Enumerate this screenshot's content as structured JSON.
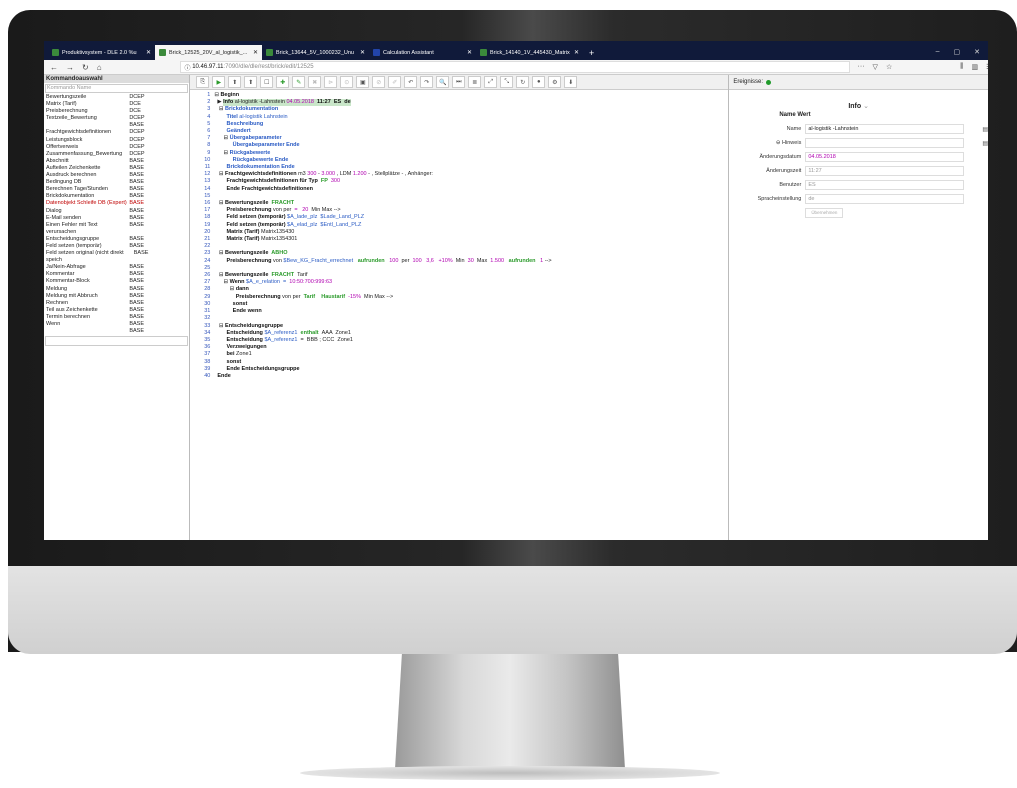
{
  "browser": {
    "tabs": [
      {
        "label": "Produktivsystem - DLE 2.0 %u",
        "active": false
      },
      {
        "label": "Brick_12525_20V_al_logistik_...",
        "active": true
      },
      {
        "label": "Brick_13644_5V_1000232_Unu",
        "active": false
      },
      {
        "label": "Calculation Assistant",
        "active": false,
        "icon": "calc"
      },
      {
        "label": "Brick_14140_1V_445430_Matrix",
        "active": false
      }
    ],
    "url_host": "10.46.97.11",
    "url_path": ":7090/dle/dle/rest/brick/edit/12525"
  },
  "left_panel": {
    "title": "Kommandoauswahl",
    "search_placeholder": "Kommando Name",
    "items": [
      {
        "name": "Bewertungszeile",
        "type": "DCEP"
      },
      {
        "name": "Matrix (Tarif)",
        "type": "DCE"
      },
      {
        "name": "Preisberechnung",
        "type": "DCE"
      },
      {
        "name": "Textzeile_Bewertung",
        "type": "DCEP"
      },
      {
        "name": "",
        "type": "BASE"
      },
      {
        "name": "Frachtgewichtsdefinitionen",
        "type": "DCEP"
      },
      {
        "name": "Leistungsblock",
        "type": "DCEP"
      },
      {
        "name": "Offertverweis",
        "type": "DCEP"
      },
      {
        "name": "Zusammenfassung_Bewertung",
        "type": "DCEP"
      },
      {
        "name": "Abschnitt",
        "type": "BASE"
      },
      {
        "name": "Aufteilen Zeichenkette",
        "type": "BASE"
      },
      {
        "name": "Ausdruck berechnen",
        "type": "BASE"
      },
      {
        "name": "Bedingung DB",
        "type": "BASE"
      },
      {
        "name": "Berechnen Tage/Stunden",
        "type": "BASE"
      },
      {
        "name": "Brickdokumentation",
        "type": "BASE"
      },
      {
        "name": "Datenobjekt Schleife DB (Expert)",
        "type": "BASE",
        "red": true
      },
      {
        "name": "Dialog",
        "type": "BASE"
      },
      {
        "name": "E-Mail senden",
        "type": "BASE"
      },
      {
        "name": "Einen Fehler mit Text verursachen",
        "type": "BASE"
      },
      {
        "name": "Entscheidungsgruppe",
        "type": "BASE"
      },
      {
        "name": "Feld setzen (temporär)",
        "type": "BASE"
      },
      {
        "name": "Feld setzen original (nicht direkt speich",
        "type": "BASE"
      },
      {
        "name": "Ja/Nein-Abfrage",
        "type": "BASE"
      },
      {
        "name": "Kommentar",
        "type": "BASE"
      },
      {
        "name": "Kommentar-Block",
        "type": "BASE"
      },
      {
        "name": "Meldung",
        "type": "BASE"
      },
      {
        "name": "Meldung mit Abbruch",
        "type": "BASE"
      },
      {
        "name": "Rechnen",
        "type": "BASE"
      },
      {
        "name": "Teil aus Zeichenkette",
        "type": "BASE"
      },
      {
        "name": "Termin berechnen",
        "type": "BASE"
      },
      {
        "name": "Wenn",
        "type": "BASE"
      },
      {
        "name": "",
        "type": "BASE"
      }
    ]
  },
  "editor": {
    "toolbar": [
      "⎘",
      "▶",
      "⬆",
      "⬆",
      "☐",
      "✚",
      "✎",
      "✖",
      "⊳",
      "⊙",
      "▣",
      "⊘",
      "✐",
      "↶",
      "↷",
      "🔍",
      "⏭",
      "≣",
      "⤢",
      "⤡",
      "↻",
      "●",
      "⚙",
      "⬇"
    ]
  },
  "code_lines": [
    [
      {
        "t": "⊟ ",
        "c": ""
      },
      {
        "t": "Beginn",
        "c": "b"
      }
    ],
    [
      {
        "t": "  ▶ ",
        "c": ""
      },
      {
        "t": "Info",
        "c": "b hl"
      },
      {
        "t": " al-logistik -Lahnstein ",
        "c": "hl"
      },
      {
        "t": "04.05.2018",
        "c": "m hl"
      },
      {
        "t": "  11:27  ES  de",
        "c": "b hl"
      }
    ],
    [
      {
        "t": "   ⊟ ",
        "c": ""
      },
      {
        "t": "Brickdokumentation",
        "c": "blb"
      }
    ],
    [
      {
        "t": "        ",
        "c": ""
      },
      {
        "t": "Titel",
        "c": "blb"
      },
      {
        "t": " al-logistik Lahnstein",
        "c": "bl"
      }
    ],
    [
      {
        "t": "        ",
        "c": ""
      },
      {
        "t": "Beschreibung",
        "c": "blb"
      }
    ],
    [
      {
        "t": "        ",
        "c": ""
      },
      {
        "t": "Geändert",
        "c": "blb"
      }
    ],
    [
      {
        "t": "      ⊟ ",
        "c": ""
      },
      {
        "t": "Übergabeparameter",
        "c": "blb"
      }
    ],
    [
      {
        "t": "            ",
        "c": ""
      },
      {
        "t": "Übergabeparameter Ende",
        "c": "blb"
      }
    ],
    [
      {
        "t": "      ⊟ ",
        "c": ""
      },
      {
        "t": "Rückgabewerte",
        "c": "blb"
      }
    ],
    [
      {
        "t": "            ",
        "c": ""
      },
      {
        "t": "Rückgabewerte Ende",
        "c": "blb"
      }
    ],
    [
      {
        "t": "        ",
        "c": ""
      },
      {
        "t": "Brickdokumentation Ende",
        "c": "blb"
      }
    ],
    [
      {
        "t": "   ⊟ ",
        "c": ""
      },
      {
        "t": "Frachtgewichtsdefinitionen",
        "c": "b"
      },
      {
        "t": " m3 ",
        "c": ""
      },
      {
        "t": "300",
        "c": "m"
      },
      {
        "t": " - ",
        "c": ""
      },
      {
        "t": "3.000",
        "c": "m"
      },
      {
        "t": " , LDM ",
        "c": ""
      },
      {
        "t": "1.200",
        "c": "m"
      },
      {
        "t": " - , Stellplätze - , Anhänger:",
        "c": ""
      }
    ],
    [
      {
        "t": "        ",
        "c": ""
      },
      {
        "t": "Frachtgewichtsdefinitionen für Typ",
        "c": "b"
      },
      {
        "t": "  FP  ",
        "c": "gr"
      },
      {
        "t": "300",
        "c": "m"
      }
    ],
    [
      {
        "t": "        ",
        "c": ""
      },
      {
        "t": "Ende Frachtgewichtsdefinitionen",
        "c": "b"
      }
    ],
    [
      {
        "t": "",
        "c": ""
      }
    ],
    [
      {
        "t": "   ⊟ ",
        "c": ""
      },
      {
        "t": "Bewertungszeile",
        "c": "b"
      },
      {
        "t": "  FRACHT",
        "c": "gr"
      }
    ],
    [
      {
        "t": "        ",
        "c": ""
      },
      {
        "t": "Preisberechnung",
        "c": "b"
      },
      {
        "t": " von per  ",
        "c": ""
      },
      {
        "t": "=   20",
        "c": "m"
      },
      {
        "t": "  Min Max -->",
        "c": ""
      }
    ],
    [
      {
        "t": "        ",
        "c": ""
      },
      {
        "t": "Feld setzen (temporär)",
        "c": "b"
      },
      {
        "t": " $A_lade_plz  $Lade_Land_PLZ",
        "c": "bl"
      }
    ],
    [
      {
        "t": "        ",
        "c": ""
      },
      {
        "t": "Feld setzen (temporär)",
        "c": "b"
      },
      {
        "t": " $A_elad_plz  $Entl_Land_PLZ",
        "c": "bl"
      }
    ],
    [
      {
        "t": "        ",
        "c": ""
      },
      {
        "t": "Matrix (Tarif)",
        "c": "b"
      },
      {
        "t": " Matrix135430",
        "c": ""
      }
    ],
    [
      {
        "t": "        ",
        "c": ""
      },
      {
        "t": "Matrix (Tarif)",
        "c": "b"
      },
      {
        "t": " Matrix1354301",
        "c": ""
      }
    ],
    [
      {
        "t": "",
        "c": ""
      }
    ],
    [
      {
        "t": "   ⊟ ",
        "c": ""
      },
      {
        "t": "Bewertungszeile",
        "c": "b"
      },
      {
        "t": "  ABHO",
        "c": "gr"
      }
    ],
    [
      {
        "t": "        ",
        "c": ""
      },
      {
        "t": "Preisberechnung",
        "c": "b"
      },
      {
        "t": " von ",
        "c": ""
      },
      {
        "t": "$Bew_KG_Fracht_errechnet",
        "c": "bl"
      },
      {
        "t": "   aufrunden   ",
        "c": "gr"
      },
      {
        "t": "100",
        "c": "m"
      },
      {
        "t": "  per  ",
        "c": ""
      },
      {
        "t": "100   3,6   +10%",
        "c": "m"
      },
      {
        "t": "  Min  ",
        "c": ""
      },
      {
        "t": "30",
        "c": "m"
      },
      {
        "t": "  Max  ",
        "c": ""
      },
      {
        "t": "1.500",
        "c": "m"
      },
      {
        "t": "   aufrunden   ",
        "c": "gr"
      },
      {
        "t": "1",
        "c": "m"
      },
      {
        "t": " -->",
        "c": ""
      }
    ],
    [
      {
        "t": "",
        "c": ""
      }
    ],
    [
      {
        "t": "   ⊟ ",
        "c": ""
      },
      {
        "t": "Bewertungszeile",
        "c": "b"
      },
      {
        "t": "  FRACHT",
        "c": "gr"
      },
      {
        "t": "  Tarif",
        "c": ""
      }
    ],
    [
      {
        "t": "      ⊟ ",
        "c": ""
      },
      {
        "t": "Wenn",
        "c": "b"
      },
      {
        "t": " $A_e_relation  =  ",
        "c": "bl"
      },
      {
        "t": "10:50:700:999:63",
        "c": "m"
      }
    ],
    [
      {
        "t": "          ⊟ ",
        "c": ""
      },
      {
        "t": "dann",
        "c": "b"
      }
    ],
    [
      {
        "t": "              ",
        "c": ""
      },
      {
        "t": "Preisberechnung",
        "c": "b"
      },
      {
        "t": " von per  ",
        "c": ""
      },
      {
        "t": "Tarif    Haustarif",
        "c": "gr"
      },
      {
        "t": "  -15%",
        "c": "m"
      },
      {
        "t": "  Min Max -->",
        "c": ""
      }
    ],
    [
      {
        "t": "            ",
        "c": ""
      },
      {
        "t": "sonst",
        "c": "b"
      }
    ],
    [
      {
        "t": "            ",
        "c": ""
      },
      {
        "t": "Ende wenn",
        "c": "b"
      }
    ],
    [
      {
        "t": "",
        "c": ""
      }
    ],
    [
      {
        "t": "   ⊟ ",
        "c": ""
      },
      {
        "t": "Entscheidungsgruppe",
        "c": "b"
      }
    ],
    [
      {
        "t": "        ",
        "c": ""
      },
      {
        "t": "Entscheidung",
        "c": "b"
      },
      {
        "t": " $A_referenz1",
        "c": "bl"
      },
      {
        "t": "  enthalt  ",
        "c": "gr"
      },
      {
        "t": "AAA  Zone1",
        "c": ""
      }
    ],
    [
      {
        "t": "        ",
        "c": ""
      },
      {
        "t": "Entscheidung",
        "c": "b"
      },
      {
        "t": " $A_referenz1",
        "c": "bl"
      },
      {
        "t": "  =  BBB ; CCC  Zone1",
        "c": ""
      }
    ],
    [
      {
        "t": "        ",
        "c": ""
      },
      {
        "t": "Verzweigungen",
        "c": "b"
      }
    ],
    [
      {
        "t": "        ",
        "c": ""
      },
      {
        "t": "bei",
        "c": "b"
      },
      {
        "t": " Zone1",
        "c": ""
      }
    ],
    [
      {
        "t": "        ",
        "c": ""
      },
      {
        "t": "sonst",
        "c": "b"
      }
    ],
    [
      {
        "t": "        ",
        "c": ""
      },
      {
        "t": "Ende Entscheidungsgruppe",
        "c": "b"
      }
    ],
    [
      {
        "t": "  ",
        "c": ""
      },
      {
        "t": "Ende",
        "c": "b"
      }
    ]
  ],
  "right_panel": {
    "events_label": "Ereignisse:",
    "title": "Info",
    "col_name": "Name",
    "col_value": "Wert",
    "fields": [
      {
        "label": "Name",
        "value": "al-logistik -Lahnstein",
        "style": "",
        "icon": "▤"
      },
      {
        "label": "⊖ Hinweis",
        "value": "",
        "style": "",
        "icon": "▤"
      },
      {
        "label": "Änderungsdatum",
        "value": "04.05.2018",
        "style": "m",
        "icon": ""
      },
      {
        "label": "Änderungszeit",
        "value": "11:27",
        "style": "gray",
        "icon": ""
      },
      {
        "label": "Benutzer",
        "value": "ES",
        "style": "gray",
        "icon": ""
      },
      {
        "label": "Spracheinstellung",
        "value": "de",
        "style": "gray",
        "icon": ""
      }
    ],
    "apply_button": "Übernehmen"
  }
}
